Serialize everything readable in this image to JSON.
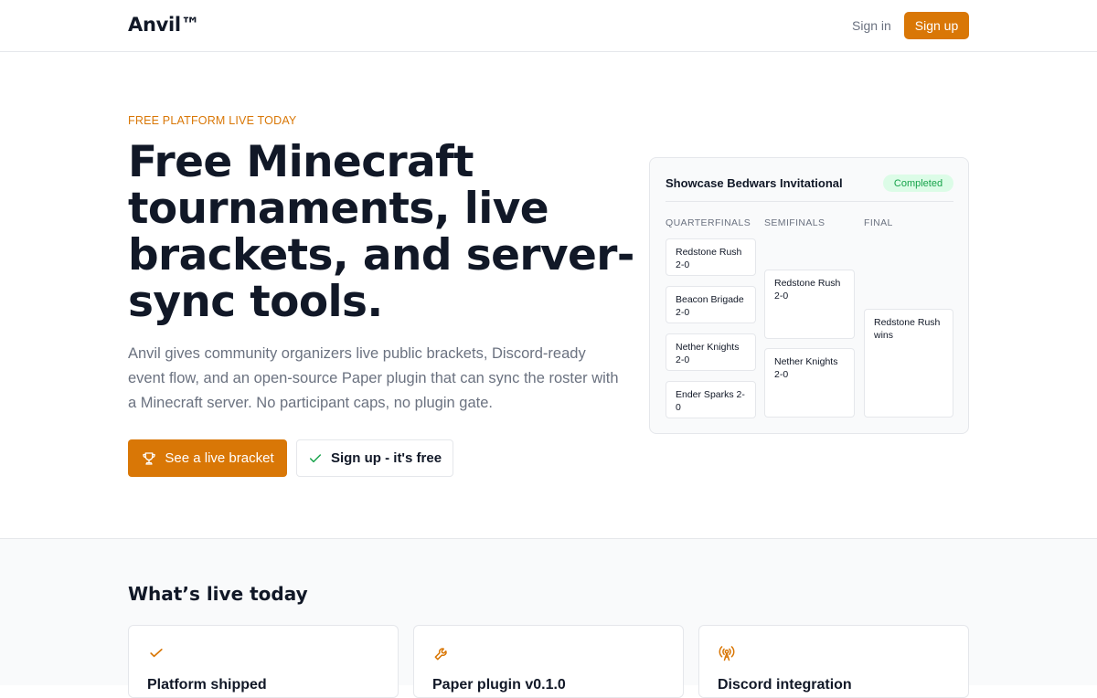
{
  "header": {
    "logo": "Anvil™",
    "signin_label": "Sign in",
    "signup_label": "Sign up"
  },
  "hero": {
    "eyebrow": "FREE PLATFORM LIVE TODAY",
    "title": "Free Minecraft tournaments, live brackets, and server-sync tools.",
    "description": "Anvil gives community organizers live public brackets, Discord-ready event flow, and an open-source Paper plugin that can sync the roster with a Minecraft server. No participant caps, no plugin gate.",
    "primary_button": "See a live bracket",
    "secondary_button": "Sign up - it's free"
  },
  "bracket": {
    "title": "Showcase Bedwars Invitational",
    "status": "Completed",
    "rounds": [
      "QUARTERFINALS",
      "SEMIFINALS",
      "FINAL"
    ],
    "quarterfinals": [
      "Redstone Rush 2-0",
      "Beacon Brigade 2-0",
      "Nether Knights 2-0",
      "Ender Sparks 2-0"
    ],
    "semifinals": [
      "Redstone Rush 2-0",
      "Nether Knights 2-0"
    ],
    "final": [
      "Redstone Rush wins"
    ]
  },
  "features": {
    "section_title": "What’s live today",
    "items": [
      {
        "title": "Platform shipped",
        "icon": "check-icon"
      },
      {
        "title": "Paper plugin v0.1.0",
        "icon": "wrench-icon"
      },
      {
        "title": "Discord integration",
        "icon": "broadcast-icon"
      }
    ]
  },
  "colors": {
    "accent": "#d97706",
    "success_bg": "#dcfce7",
    "success_text": "#16a34a"
  }
}
